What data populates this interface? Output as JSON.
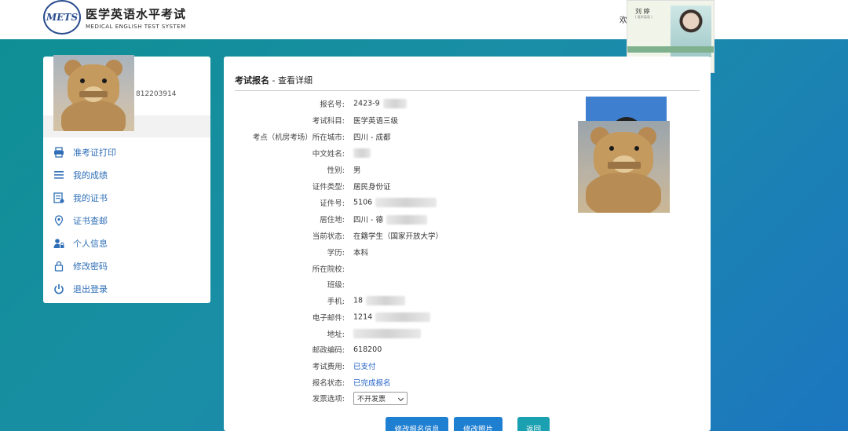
{
  "header": {
    "logo_mark": "METS",
    "logo_cn": "医学英语水平考试",
    "logo_en": "MEDICAL ENGLISH TEST SYSTEM",
    "welcome": "欢"
  },
  "ad": {
    "name": "刘 婷",
    "subtitle": "( 医学英语 )"
  },
  "sidebar": {
    "user_id": "812203914",
    "items": [
      {
        "label": "准考证打印",
        "icon": "printer-icon"
      },
      {
        "label": "我的成绩",
        "icon": "list-icon"
      },
      {
        "label": "我的证书",
        "icon": "certificate-icon"
      },
      {
        "label": "证书查邮",
        "icon": "location-pin-icon"
      },
      {
        "label": "个人信息",
        "icon": "user-lock-icon"
      },
      {
        "label": "修改密码",
        "icon": "lock-icon"
      },
      {
        "label": "退出登录",
        "icon": "power-icon"
      }
    ]
  },
  "detail": {
    "title_bold": "考试报名",
    "title_rest": " - 查看详细",
    "fields": [
      {
        "label": "报名号:",
        "value": "2423-9"
      },
      {
        "label": "考试科目:",
        "value": "医学英语三级"
      },
      {
        "label": "考点（机房考场）所在城市:",
        "value": "四川 - 成都"
      },
      {
        "label": "中文姓名:",
        "value": ""
      },
      {
        "label": "性别:",
        "value": "男"
      },
      {
        "label": "证件类型:",
        "value": "居民身份证"
      },
      {
        "label": "证件号:",
        "value": "5106"
      },
      {
        "label": "居住地:",
        "value": "四川 - 德"
      },
      {
        "label": "当前状态:",
        "value": "在籍学生（国家开放大学）"
      },
      {
        "label": "学历:",
        "value": "本科"
      },
      {
        "label": "所在院校:",
        "value": ""
      },
      {
        "label": "班级:",
        "value": ""
      },
      {
        "label": "手机:",
        "value": "18"
      },
      {
        "label": "电子邮件:",
        "value": "1214"
      },
      {
        "label": "地址:",
        "value": ""
      },
      {
        "label": "邮政编码:",
        "value": "618200"
      },
      {
        "label": "考试费用:",
        "value": "已支付"
      },
      {
        "label": "报名状态:",
        "value": "已完成报名"
      },
      {
        "label": "发票选项:",
        "value": "不开发票"
      }
    ],
    "buttons": {
      "edit_info": "修改报名信息",
      "edit_photo": "修改照片",
      "back": "返回"
    }
  },
  "colors": {
    "link_blue": "#2f6fb7",
    "status_blue": "#1f5fc7",
    "button_blue": "#1f7fd1",
    "button_teal": "#1aa0b0"
  }
}
